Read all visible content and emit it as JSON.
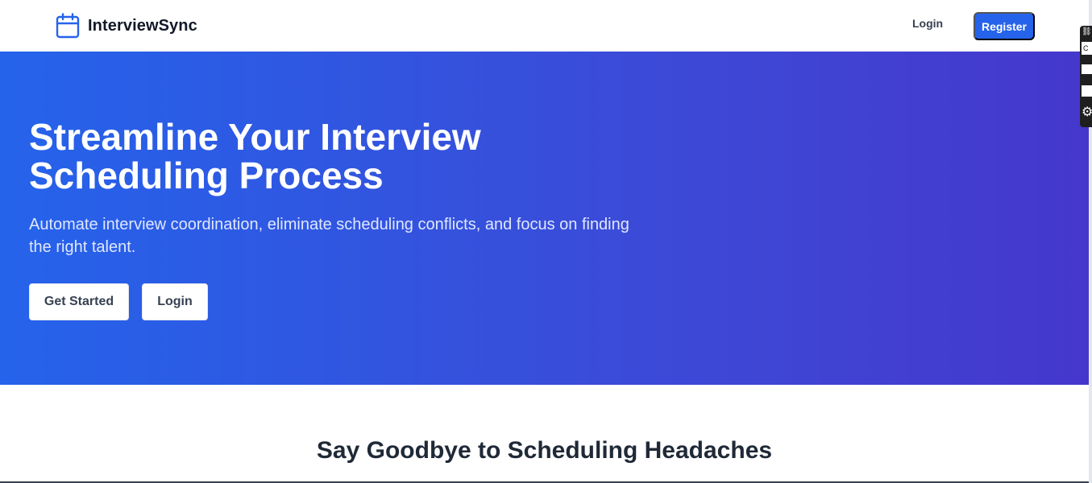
{
  "nav": {
    "brand_name": "InterviewSync",
    "brand_icon": "calendar-icon",
    "login_label": "Login",
    "register_label": "Register"
  },
  "hero": {
    "title": "Streamline Your Interview Scheduling Process",
    "subtitle": "Automate interview coordination, eliminate scheduling conflicts, and focus on finding the right talent.",
    "get_started_label": "Get Started",
    "login_label": "Login"
  },
  "section": {
    "title": "Say Goodbye to Scheduling Headaches"
  },
  "extension_widget": {
    "c_label": "C",
    "icons": [
      "link-icon",
      "gear-icon"
    ]
  },
  "colors": {
    "primary": "#2563eb",
    "hero_gradient_start": "#2563eb",
    "hero_gradient_end": "#4537cc",
    "white": "#ffffff",
    "heading_text": "#1f2937"
  }
}
